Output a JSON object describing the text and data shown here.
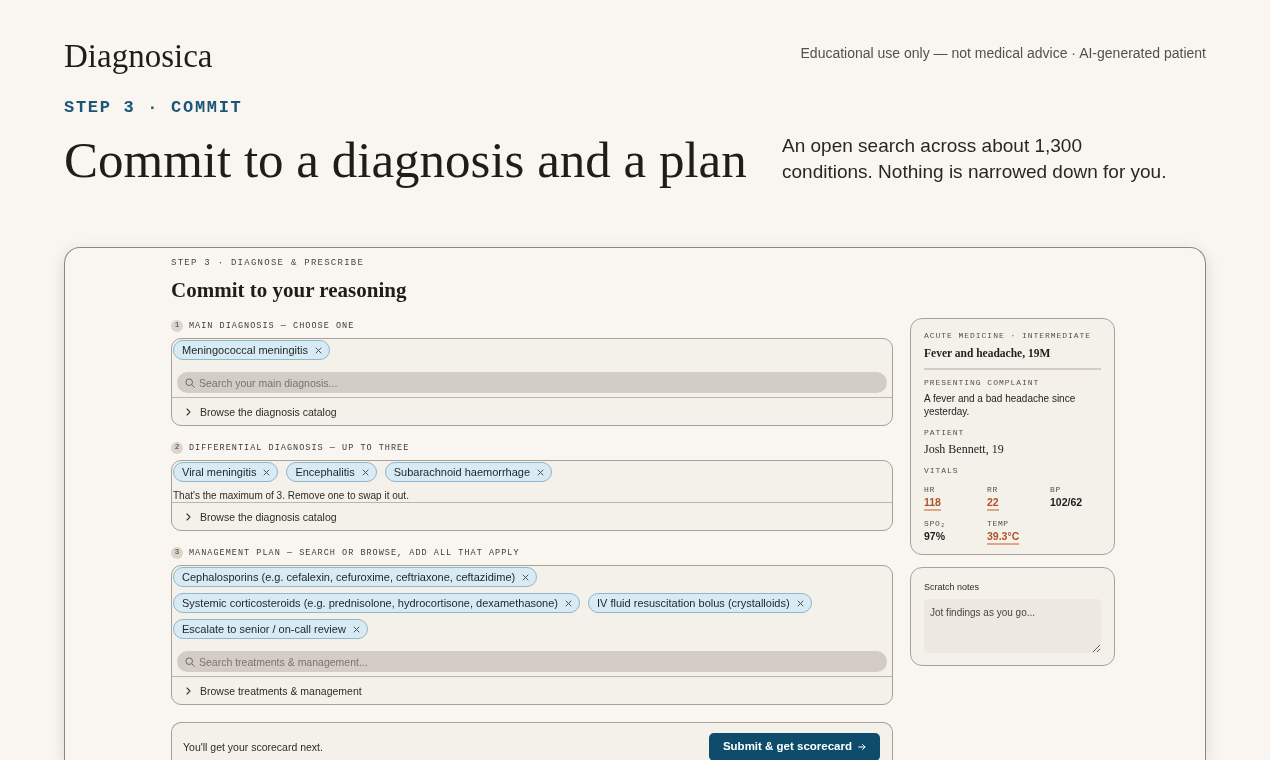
{
  "header": {
    "logo": "Diagnosica",
    "disclaimer": "Educational use only — not medical advice · AI-generated patient"
  },
  "hero": {
    "eyebrow": "STEP 3 · COMMIT",
    "title": "Commit to a diagnosis and a plan",
    "description": "An open search across about 1,300 conditions. Nothing is narrowed down for you."
  },
  "panel": {
    "eyebrow": "STEP 3 · DIAGNOSE & PRESCRIBE",
    "title": "Commit to your reasoning",
    "sections": [
      {
        "number": "1",
        "label": "MAIN DIAGNOSIS — CHOOSE ONE",
        "chips": [
          "Meningococcal meningitis"
        ],
        "search_placeholder": "Search your main diagnosis...",
        "browse": "Browse the diagnosis catalog"
      },
      {
        "number": "2",
        "label": "DIFFERENTIAL DIAGNOSIS — UP TO THREE",
        "chips": [
          "Viral meningitis",
          "Encephalitis",
          "Subarachnoid haemorrhage"
        ],
        "note": "That's the maximum of 3. Remove one to swap it out.",
        "browse": "Browse the diagnosis catalog"
      },
      {
        "number": "3",
        "label": "MANAGEMENT PLAN — SEARCH OR BROWSE, ADD ALL THAT APPLY",
        "chips": [
          "Cephalosporins (e.g. cefalexin, cefuroxime, ceftriaxone, ceftazidime)",
          "Systemic corticosteroids (e.g. prednisolone, hydrocortisone, dexamethasone)",
          "IV fluid resuscitation bolus (crystalloids)",
          "Escalate to senior / on-call review"
        ],
        "search_placeholder": "Search treatments & management...",
        "browse": "Browse treatments & management"
      }
    ],
    "submit": {
      "note": "You'll get your scorecard next.",
      "button": "Submit & get scorecard"
    }
  },
  "case": {
    "eyebrow": "ACUTE MEDICINE · INTERMEDIATE",
    "title": "Fever and headache, 19M",
    "complaint_label": "PRESENTING COMPLAINT",
    "complaint": "A fever and a bad headache since yesterday.",
    "patient_label": "PATIENT",
    "patient": "Josh Bennett, 19",
    "vitals_label": "VITALS",
    "vitals": [
      {
        "label": "HR",
        "value": "118",
        "abnormal": true
      },
      {
        "label": "RR",
        "value": "22",
        "abnormal": true
      },
      {
        "label": "BP",
        "value": "102/62",
        "abnormal": false
      },
      {
        "label": "SPO₂",
        "value": "97%",
        "abnormal": false
      },
      {
        "label": "TEMP",
        "value": "39.3°C",
        "abnormal": true
      }
    ]
  },
  "notes": {
    "label": "Scratch notes",
    "placeholder": "Jot findings as you go..."
  }
}
